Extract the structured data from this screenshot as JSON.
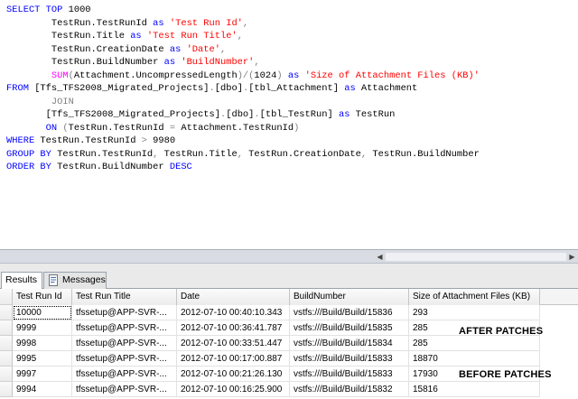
{
  "editor": {
    "lines": [
      [
        {
          "t": "SELECT TOP ",
          "c": "kw"
        },
        {
          "t": "1000",
          "c": ""
        }
      ],
      [
        {
          "t": "        TestRun.TestRunId ",
          "c": ""
        },
        {
          "t": "as",
          "c": "kw"
        },
        {
          "t": " ",
          "c": ""
        },
        {
          "t": "'Test Run Id'",
          "c": "str"
        },
        {
          "t": ",",
          "c": "gr"
        }
      ],
      [
        {
          "t": "        TestRun.Title ",
          "c": ""
        },
        {
          "t": "as",
          "c": "kw"
        },
        {
          "t": " ",
          "c": ""
        },
        {
          "t": "'Test Run Title'",
          "c": "str"
        },
        {
          "t": ",",
          "c": "gr"
        }
      ],
      [
        {
          "t": "        TestRun.CreationDate ",
          "c": ""
        },
        {
          "t": "as",
          "c": "kw"
        },
        {
          "t": " ",
          "c": ""
        },
        {
          "t": "'Date'",
          "c": "str"
        },
        {
          "t": ",",
          "c": "gr"
        }
      ],
      [
        {
          "t": "        TestRun.BuildNumber ",
          "c": ""
        },
        {
          "t": "as",
          "c": "kw"
        },
        {
          "t": " ",
          "c": ""
        },
        {
          "t": "'BuildNumber'",
          "c": "str"
        },
        {
          "t": ",",
          "c": "gr"
        }
      ],
      [
        {
          "t": "        ",
          "c": ""
        },
        {
          "t": "SUM",
          "c": "fn"
        },
        {
          "t": "(",
          "c": "gr"
        },
        {
          "t": "Attachment.UncompressedLength",
          "c": ""
        },
        {
          "t": ")/(",
          "c": "gr"
        },
        {
          "t": "1024",
          "c": ""
        },
        {
          "t": ")",
          "c": "gr"
        },
        {
          "t": " ",
          "c": ""
        },
        {
          "t": "as",
          "c": "kw"
        },
        {
          "t": " ",
          "c": ""
        },
        {
          "t": "'Size of Attachment Files (KB)'",
          "c": "str"
        }
      ],
      [
        {
          "t": "FROM ",
          "c": "kw"
        },
        {
          "t": "[Tfs_TFS2008_Migrated_Projects]",
          "c": ""
        },
        {
          "t": ".",
          "c": "gr"
        },
        {
          "t": "[dbo]",
          "c": ""
        },
        {
          "t": ".",
          "c": "gr"
        },
        {
          "t": "[tbl_Attachment] ",
          "c": ""
        },
        {
          "t": "as",
          "c": "kw"
        },
        {
          "t": " Attachment",
          "c": ""
        }
      ],
      [
        {
          "t": "        JOIN",
          "c": "gr"
        }
      ],
      [
        {
          "t": "       ",
          "c": ""
        },
        {
          "t": "[Tfs_TFS2008_Migrated_Projects]",
          "c": ""
        },
        {
          "t": ".",
          "c": "gr"
        },
        {
          "t": "[dbo]",
          "c": ""
        },
        {
          "t": ".",
          "c": "gr"
        },
        {
          "t": "[tbl_TestRun] ",
          "c": ""
        },
        {
          "t": "as",
          "c": "kw"
        },
        {
          "t": " TestRun",
          "c": ""
        }
      ],
      [
        {
          "t": "       ",
          "c": ""
        },
        {
          "t": "ON",
          "c": "kw"
        },
        {
          "t": " ",
          "c": ""
        },
        {
          "t": "(",
          "c": "gr"
        },
        {
          "t": "TestRun.TestRunId ",
          "c": ""
        },
        {
          "t": "=",
          "c": "gr"
        },
        {
          "t": " Attachment.TestRunId",
          "c": ""
        },
        {
          "t": ")",
          "c": "gr"
        }
      ],
      [
        {
          "t": "WHERE",
          "c": "kw"
        },
        {
          "t": " TestRun.TestRunId ",
          "c": ""
        },
        {
          "t": ">",
          "c": "gr"
        },
        {
          "t": " 9980",
          "c": ""
        }
      ],
      [
        {
          "t": "GROUP BY",
          "c": "kw"
        },
        {
          "t": " TestRun.TestRunId",
          "c": ""
        },
        {
          "t": ",",
          "c": "gr"
        },
        {
          "t": " TestRun.Title",
          "c": ""
        },
        {
          "t": ",",
          "c": "gr"
        },
        {
          "t": " TestRun.CreationDate",
          "c": ""
        },
        {
          "t": ",",
          "c": "gr"
        },
        {
          "t": " TestRun.BuildNumber",
          "c": ""
        }
      ],
      [
        {
          "t": "ORDER BY",
          "c": "kw"
        },
        {
          "t": " TestRun.BuildNumber ",
          "c": ""
        },
        {
          "t": "DESC",
          "c": "kw"
        }
      ]
    ]
  },
  "scrollbar": {
    "left_glyph": "◀",
    "right_glyph": "▶"
  },
  "tabs": {
    "results_label": "Results",
    "messages_label": "Messages",
    "messages_icon": "messages-page-icon"
  },
  "grid": {
    "columns": [
      "Test Run Id",
      "Test Run Title",
      "Date",
      "BuildNumber",
      "Size of Attachment Files (KB)"
    ],
    "rows": [
      [
        "10000",
        "tfssetup@APP-SVR-...",
        "2012-07-10 00:40:10.343",
        "vstfs:///Build/Build/15836",
        "293"
      ],
      [
        "9999",
        "tfssetup@APP-SVR-...",
        "2012-07-10 00:36:41.787",
        "vstfs:///Build/Build/15835",
        "285"
      ],
      [
        "9998",
        "tfssetup@APP-SVR-...",
        "2012-07-10 00:33:51.447",
        "vstfs:///Build/Build/15834",
        "285"
      ],
      [
        "9995",
        "tfssetup@APP-SVR-...",
        "2012-07-10 00:17:00.887",
        "vstfs:///Build/Build/15833",
        "18870"
      ],
      [
        "9997",
        "tfssetup@APP-SVR-...",
        "2012-07-10 00:21:26.130",
        "vstfs:///Build/Build/15833",
        "17930"
      ],
      [
        "9994",
        "tfssetup@APP-SVR-...",
        "2012-07-10 00:16:25.900",
        "vstfs:///Build/Build/15832",
        "15816"
      ]
    ]
  },
  "annotations": {
    "after": "AFTER PATCHES",
    "before": "BEFORE PATCHES"
  }
}
